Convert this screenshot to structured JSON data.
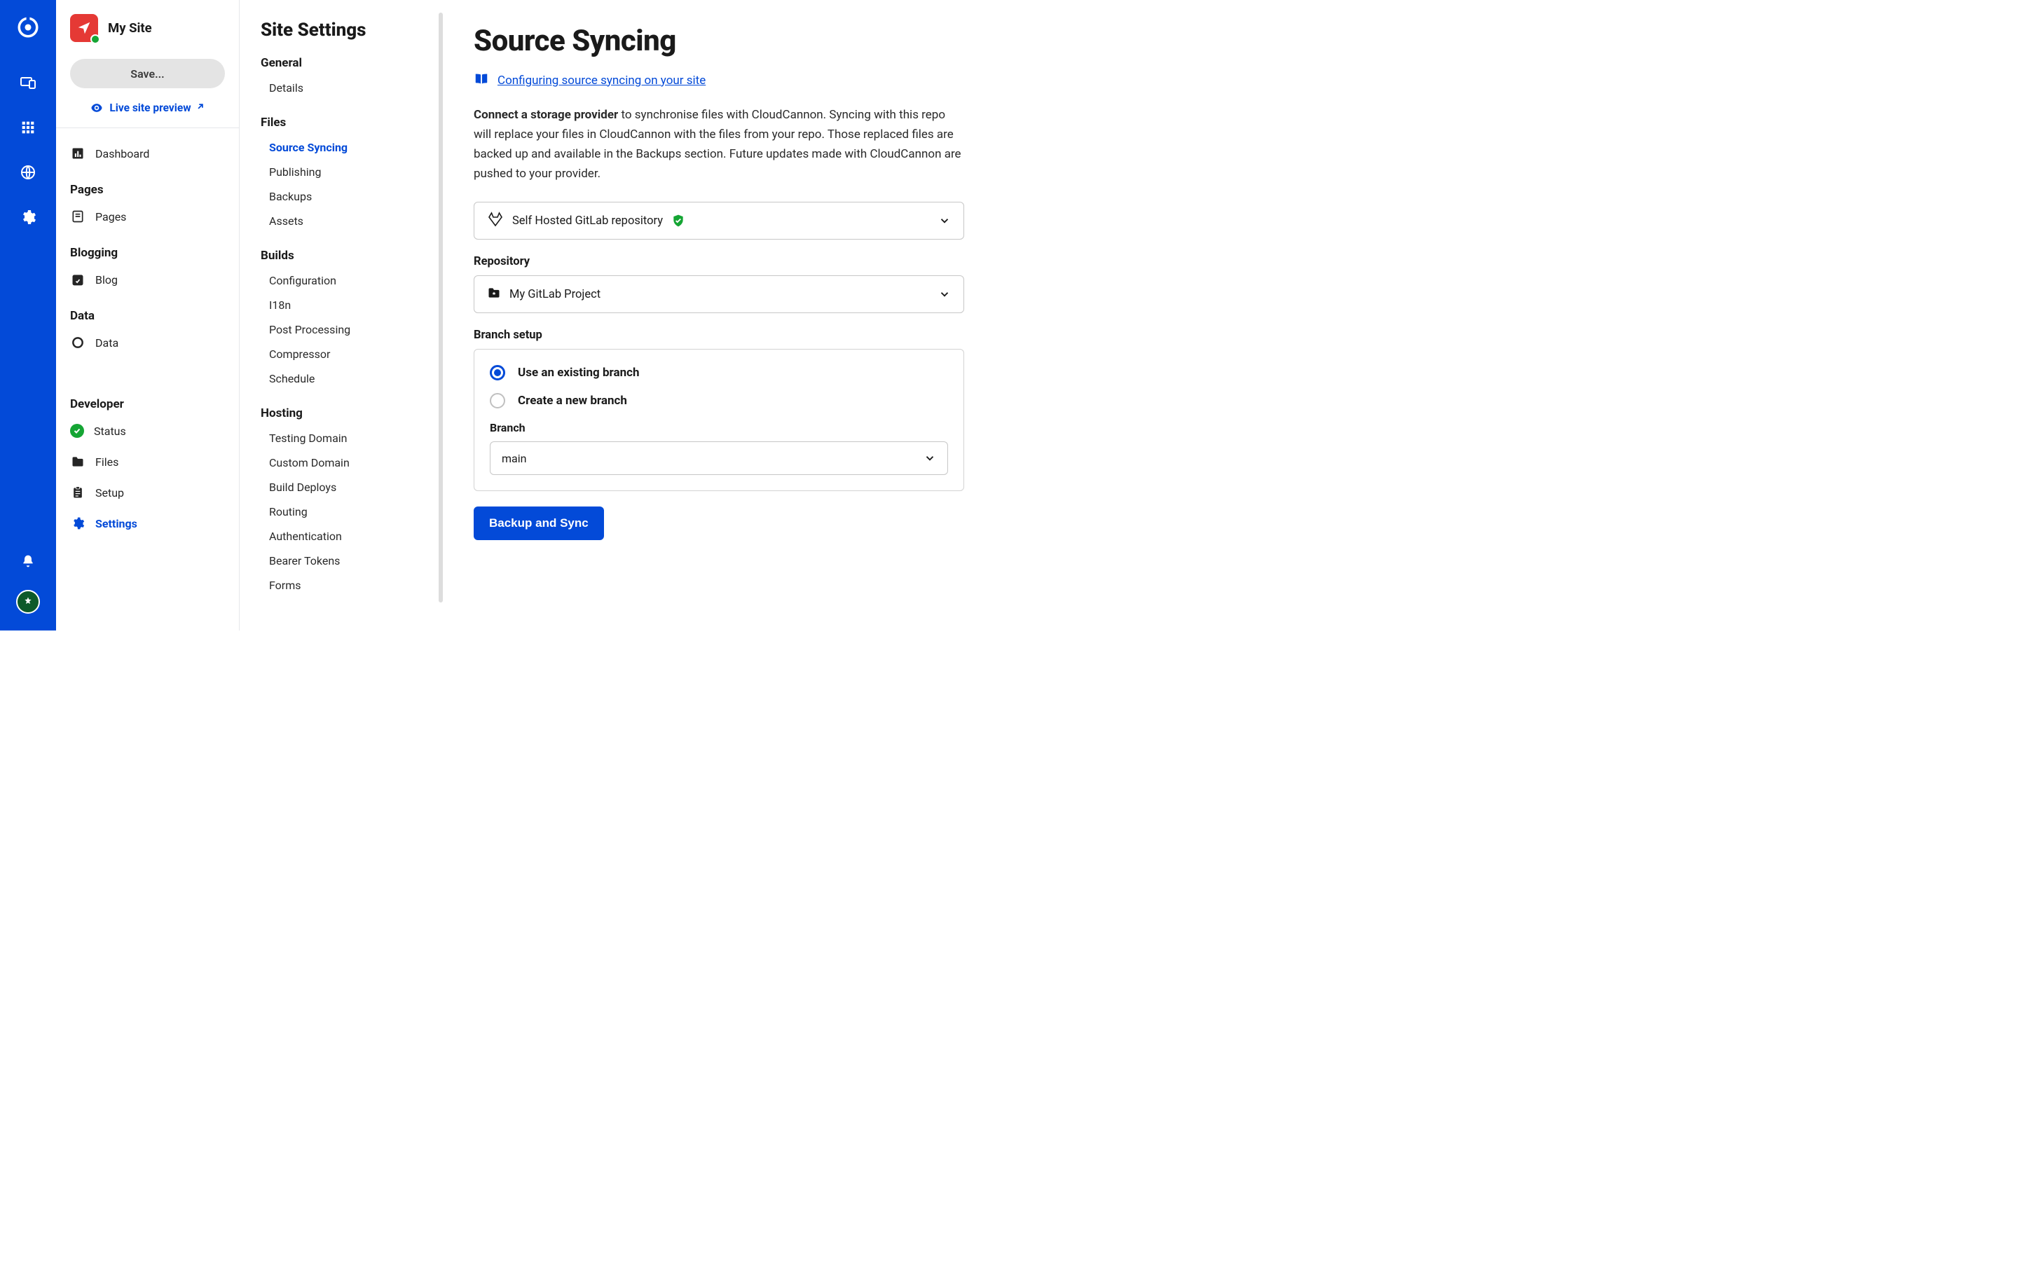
{
  "site": {
    "name": "My Site"
  },
  "snav": {
    "save_label": "Save...",
    "preview_label": "Live site preview",
    "dashboard_label": "Dashboard",
    "groups": {
      "pages": {
        "title": "Pages",
        "item": "Pages"
      },
      "blogging": {
        "title": "Blogging",
        "item": "Blog"
      },
      "data": {
        "title": "Data",
        "item": "Data"
      },
      "developer": {
        "title": "Developer",
        "status": "Status",
        "files": "Files",
        "setup": "Setup",
        "settings": "Settings"
      }
    }
  },
  "settings": {
    "title": "Site Settings",
    "general": {
      "title": "General",
      "details": "Details"
    },
    "files": {
      "title": "Files",
      "source_syncing": "Source Syncing",
      "publishing": "Publishing",
      "backups": "Backups",
      "assets": "Assets"
    },
    "builds": {
      "title": "Builds",
      "configuration": "Configuration",
      "i18n": "I18n",
      "post_processing": "Post Processing",
      "compressor": "Compressor",
      "schedule": "Schedule"
    },
    "hosting": {
      "title": "Hosting",
      "testing_domain": "Testing Domain",
      "custom_domain": "Custom Domain",
      "build_deploys": "Build Deploys",
      "routing": "Routing",
      "authentication": "Authentication",
      "bearer_tokens": "Bearer Tokens",
      "forms": "Forms"
    }
  },
  "main": {
    "title": "Source Syncing",
    "doc_link": "Configuring source syncing on your site",
    "desc_bold": "Connect a storage provider",
    "desc_rest": " to synchronise files with CloudCannon. Syncing with this repo will replace your files in CloudCannon with the files from your repo. Those replaced files are backed up and available in the Backups section. Future updates made with CloudCannon are pushed to your provider.",
    "provider_selected": "Self Hosted GitLab repository",
    "repository_label": "Repository",
    "repository_selected": "My GitLab Project",
    "branch_setup_label": "Branch setup",
    "branch_existing": "Use an existing branch",
    "branch_create": "Create a new branch",
    "branch_label": "Branch",
    "branch_selected": "main",
    "submit_label": "Backup and Sync"
  }
}
